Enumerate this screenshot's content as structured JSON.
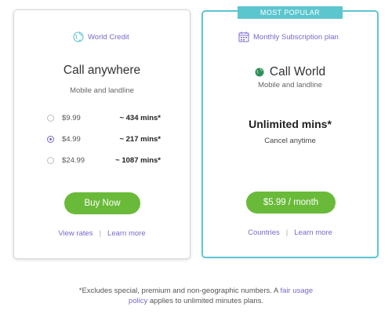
{
  "badge": "MOST POPULAR",
  "left_card": {
    "header": "World Credit",
    "header_icon": "globe-icon",
    "title": "Call anywhere",
    "subtitle": "Mobile and landline",
    "options": [
      {
        "price": "$9.99",
        "mins": "~ 434 mins*",
        "selected": false
      },
      {
        "price": "$4.99",
        "mins": "~ 217 mins*",
        "selected": true
      },
      {
        "price": "$24.99",
        "mins": "~ 1087 mins*",
        "selected": false
      }
    ],
    "button": "Buy Now",
    "link1": "View rates",
    "separator": "|",
    "link2": "Learn more"
  },
  "right_card": {
    "header": "Monthly Subscription plan",
    "header_icon": "calendar-icon",
    "title": "Call World",
    "title_icon": "globe-icon",
    "subtitle": "Mobile and landline",
    "unlimited": "Unlimited mins*",
    "cancel": "Cancel anytime",
    "button": "$5.99 / month",
    "link1": "Countries",
    "separator": "|",
    "link2": "Learn more"
  },
  "footnote": {
    "text1": "*Excludes special, premium and non-geographic numbers. A",
    "link_part1": "fair usage",
    "link_part2": "policy",
    "text2": "applies to unlimited minutes plans."
  },
  "colors": {
    "accent": "#7b68c8",
    "teal": "#5cc6cf",
    "green": "#6aba3a"
  }
}
